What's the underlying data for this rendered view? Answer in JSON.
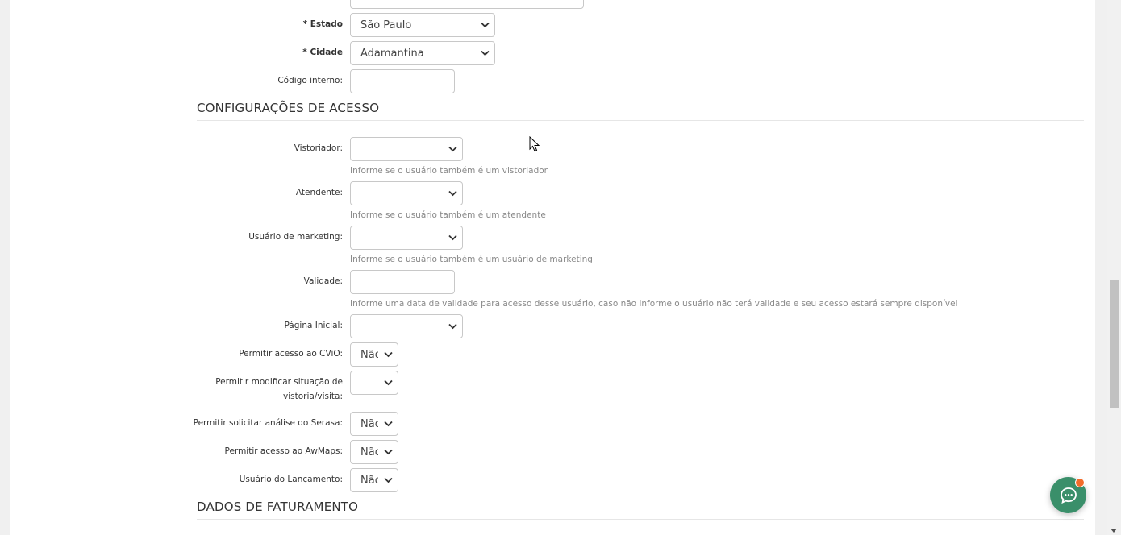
{
  "form": {
    "estado": {
      "label": "* Estado",
      "value": "São Paulo"
    },
    "cidade": {
      "label": "* Cidade",
      "value": "Adamantina"
    },
    "codigo": {
      "label": "Código interno:",
      "value": ""
    }
  },
  "access_section": {
    "title": "CONFIGURAÇÕES DE ACESSO",
    "vistoriador": {
      "label": "Vistoriador:",
      "value": "",
      "help": "Informe se o usuário também é um vistoriador"
    },
    "atendente": {
      "label": "Atendente:",
      "value": "",
      "help": "Informe se o usuário também é um atendente"
    },
    "marketing": {
      "label": "Usuário de marketing:",
      "value": "",
      "help": "Informe se o usuário também é um usuário de marketing"
    },
    "validade": {
      "label": "Validade:",
      "value": "",
      "help": "Informe uma data de validade para acesso desse usuário, caso não informe o usuário não terá validade e seu acesso estará sempre disponível"
    },
    "pagina_inicial": {
      "label": "Página Inicial:",
      "value": ""
    },
    "cvio": {
      "label": "Permitir acesso ao CViO:",
      "value": "Não"
    },
    "modificar": {
      "label_line1": "Permitir modificar situação de",
      "label_line2": "vistoria/visita:",
      "value": ""
    },
    "serasa": {
      "label": "Permitir solicitar análise do Serasa:",
      "value": "Não"
    },
    "awmaps": {
      "label": "Permitir acesso ao AwMaps:",
      "value": "Não"
    },
    "lancamento": {
      "label": "Usuário do Lançamento:",
      "value": "Não"
    }
  },
  "billing_section": {
    "title": "DADOS DE FATURAMENTO"
  },
  "colors": {
    "accent": "#3a8f6a",
    "notification": "#f26b2a"
  },
  "icons": {
    "chat": "chat-bubble-icon",
    "chevron": "chevron-down-icon"
  }
}
